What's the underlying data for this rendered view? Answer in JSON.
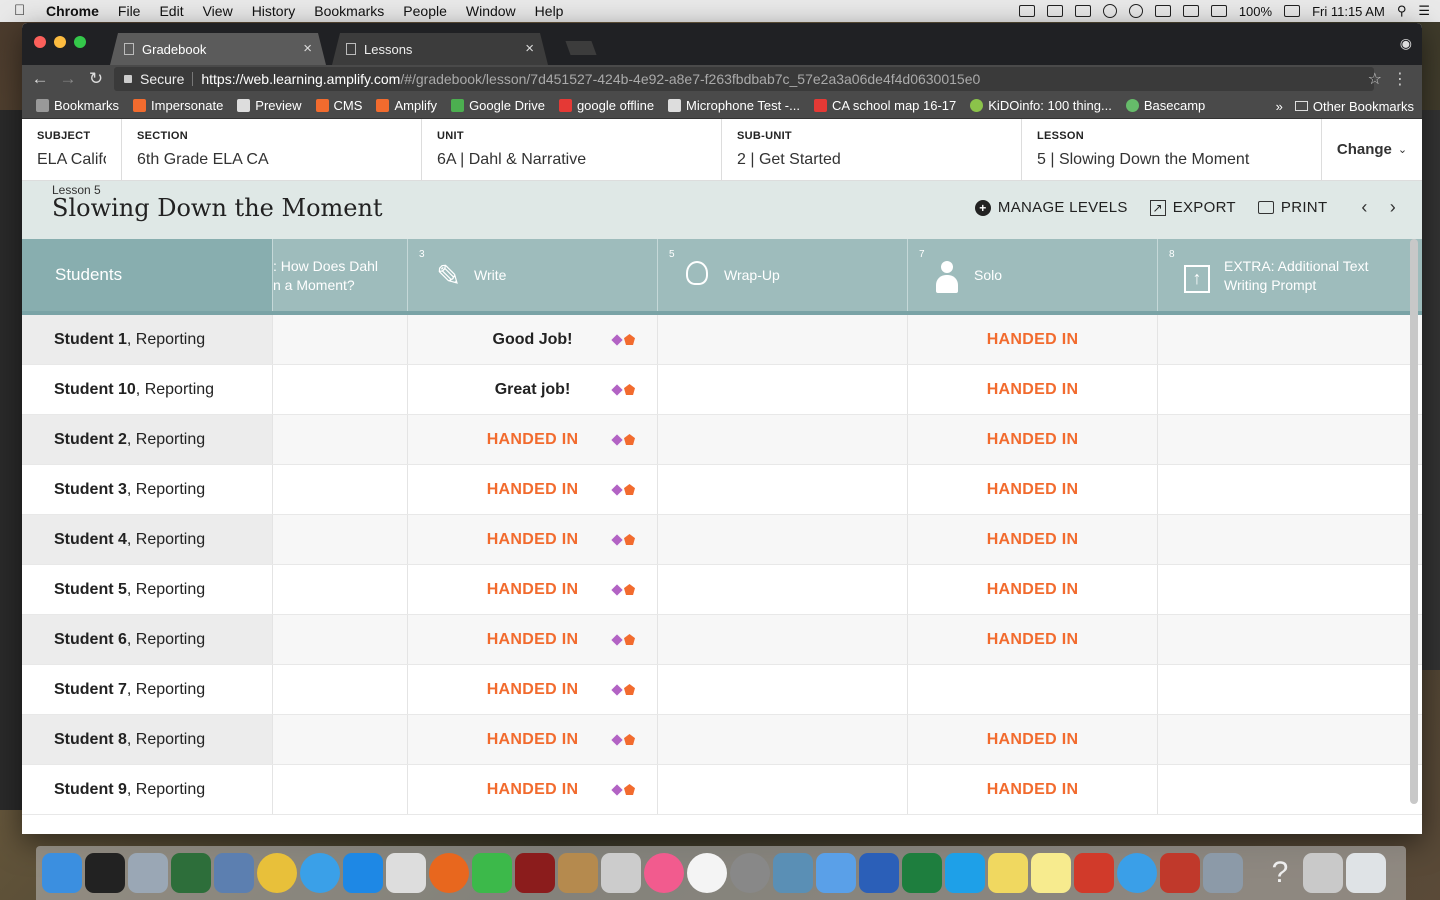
{
  "menubar": {
    "app": "Chrome",
    "items": [
      "File",
      "Edit",
      "View",
      "History",
      "Bookmarks",
      "People",
      "Window",
      "Help"
    ],
    "battery": "100%",
    "clock": "Fri 11:15 AM"
  },
  "tabs": [
    {
      "label": "Gradebook",
      "active": true
    },
    {
      "label": "Lessons",
      "active": false
    }
  ],
  "omnibox": {
    "secure_label": "Secure",
    "url_host": "https://web.learning.amplify.com",
    "url_rest": "/#/gradebook/lesson/7d451527-424b-4e92-a8e7-f263fbdbab7c_57e2a3a06de4f4d0630015e0"
  },
  "bookmarks": {
    "items": [
      {
        "label": "Bookmarks",
        "color": "#999999"
      },
      {
        "label": "Impersonate",
        "color": "#f26b2e"
      },
      {
        "label": "Preview",
        "color": "#dddddd"
      },
      {
        "label": "CMS",
        "color": "#f26b2e"
      },
      {
        "label": "Amplify",
        "color": "#f26b2e"
      },
      {
        "label": "Google Drive",
        "color": "#4caf50"
      },
      {
        "label": "google offline",
        "color": "#e53935"
      },
      {
        "label": "Microphone Test -...",
        "color": "#dddddd"
      },
      {
        "label": "CA school map 16-17",
        "color": "#e53935"
      },
      {
        "label": "KiDOinfo: 100 thing...",
        "color": "#8bc34a"
      },
      {
        "label": "Basecamp",
        "color": "#66bb6a"
      }
    ],
    "overflow": "»",
    "other": "Other Bookmarks"
  },
  "header": {
    "subject_label": "SUBJECT",
    "subject_value": "ELA Califo..",
    "section_label": "SECTION",
    "section_value": "6th Grade ELA CA",
    "unit_label": "UNIT",
    "unit_value": "6A | Dahl & Narrative",
    "subunit_label": "SUB-UNIT",
    "subunit_value": "2 | Get Started",
    "lesson_label": "LESSON",
    "lesson_value": "5 | Slowing Down the Moment",
    "change_label": "Change"
  },
  "lesson": {
    "small": "Lesson 5",
    "title": "Slowing Down the Moment",
    "manage_levels": "MANAGE LEVELS",
    "export": "EXPORT",
    "print": "PRINT"
  },
  "grid": {
    "students_header": "Students",
    "columns": [
      {
        "num": "",
        "name_line1": ": How Does Dahl",
        "name_line2": "n a Moment?",
        "icon": "none"
      },
      {
        "num": "3",
        "name_line1": "Write",
        "name_line2": "",
        "icon": "pen-icon"
      },
      {
        "num": "5",
        "name_line1": "Wrap-Up",
        "name_line2": "",
        "icon": "lightbulb-icon"
      },
      {
        "num": "7",
        "name_line1": "Solo",
        "name_line2": "",
        "icon": "person-icon"
      },
      {
        "num": "8",
        "name_line1": "EXTRA: Additional Text",
        "name_line2": "Writing Prompt",
        "icon": "upload-icon"
      }
    ],
    "rows": [
      {
        "name": "Student 1",
        "status": ", Reporting",
        "write": "Good Job!",
        "write_type": "grade",
        "solo": "HANDED IN"
      },
      {
        "name": "Student 10",
        "status": ", Reporting",
        "write": "Great job!",
        "write_type": "grade",
        "solo": "HANDED IN"
      },
      {
        "name": "Student 2",
        "status": ", Reporting",
        "write": "HANDED IN",
        "write_type": "handed",
        "solo": "HANDED IN"
      },
      {
        "name": "Student 3",
        "status": ", Reporting",
        "write": "HANDED IN",
        "write_type": "handed",
        "solo": "HANDED IN"
      },
      {
        "name": "Student 4",
        "status": ", Reporting",
        "write": "HANDED IN",
        "write_type": "handed",
        "solo": "HANDED IN"
      },
      {
        "name": "Student 5",
        "status": ", Reporting",
        "write": "HANDED IN",
        "write_type": "handed",
        "solo": "HANDED IN"
      },
      {
        "name": "Student 6",
        "status": ", Reporting",
        "write": "HANDED IN",
        "write_type": "handed",
        "solo": "HANDED IN"
      },
      {
        "name": "Student 7",
        "status": ", Reporting",
        "write": "HANDED IN",
        "write_type": "handed",
        "solo": ""
      },
      {
        "name": "Student 8",
        "status": ", Reporting",
        "write": "HANDED IN",
        "write_type": "handed",
        "solo": "HANDED IN"
      },
      {
        "name": "Student 9",
        "status": ", Reporting",
        "write": "HANDED IN",
        "write_type": "handed",
        "solo": "HANDED IN"
      }
    ]
  },
  "colors": {
    "accent_orange": "#f26b2e",
    "accent_purple": "#b263c4",
    "header_teal": "#9ebcbc"
  }
}
